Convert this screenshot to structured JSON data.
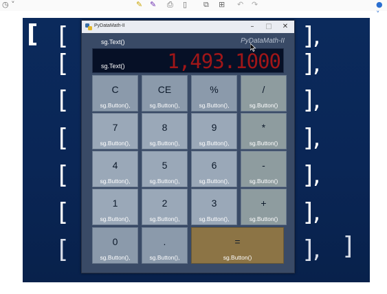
{
  "toolbar": {
    "items": [
      "◷ ˅",
      "✎",
      "✎",
      "⎙",
      "▯",
      "⧉",
      "⊞",
      "↶",
      "↷",
      "● ˅"
    ]
  },
  "window": {
    "title": "PyDataMath-II",
    "minimize": "–",
    "maximize": "□",
    "close": "✕"
  },
  "calculator": {
    "brand": "PyDataMath-II",
    "label_top": "sg.Text()",
    "label_display": "sg.Text()",
    "display_value": "1,493.1000",
    "rows": [
      [
        {
          "sym": "C",
          "sub": "sg.Button(),"
        },
        {
          "sym": "CE",
          "sub": "sg.Button(),"
        },
        {
          "sym": "%",
          "sub": "sg.Button(),"
        },
        {
          "sym": "/",
          "sub": "sg.Button()"
        }
      ],
      [
        {
          "sym": "7",
          "sub": "sg.Button(),"
        },
        {
          "sym": "8",
          "sub": "sg.Button(),"
        },
        {
          "sym": "9",
          "sub": "sg.Button(),"
        },
        {
          "sym": "*",
          "sub": "sg.Button()"
        }
      ],
      [
        {
          "sym": "4",
          "sub": "sg.Button(),"
        },
        {
          "sym": "5",
          "sub": "sg.Button(),"
        },
        {
          "sym": "6",
          "sub": "sg.Button(),"
        },
        {
          "sym": "-",
          "sub": "sg.Button()"
        }
      ],
      [
        {
          "sym": "1",
          "sub": "sg.Button(),"
        },
        {
          "sym": "2",
          "sub": "sg.Button(),"
        },
        {
          "sym": "3",
          "sub": "sg.Button(),"
        },
        {
          "sym": "+",
          "sub": "sg.Button()"
        }
      ],
      [
        {
          "sym": "0",
          "sub": "sg.Button(),"
        },
        {
          "sym": ".",
          "sub": "sg.Button(),"
        },
        {
          "sym": "=",
          "sub": "sg.Button()"
        }
      ]
    ]
  },
  "slide": {
    "outer_open": "[",
    "row_open": "[",
    "row_close": "],",
    "outer_close": "]"
  },
  "colors": {
    "slide_bg": "#0a2656",
    "display_digits": "#a01618",
    "equals_key": "#8c7445"
  }
}
